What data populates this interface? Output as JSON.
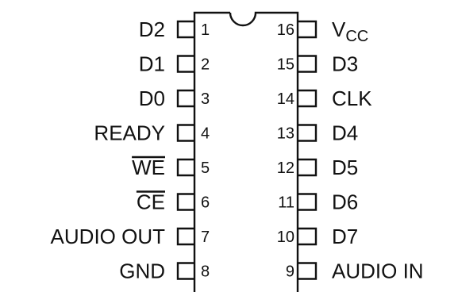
{
  "chip": {
    "left_pins": [
      {
        "number": "1",
        "label": "D2"
      },
      {
        "number": "2",
        "label": "D1"
      },
      {
        "number": "3",
        "label": "D0"
      },
      {
        "number": "4",
        "label": "READY"
      },
      {
        "number": "5",
        "label": "WE",
        "overline": true
      },
      {
        "number": "6",
        "label": "CE",
        "overline": true
      },
      {
        "number": "7",
        "label": "AUDIO OUT"
      },
      {
        "number": "8",
        "label": "GND"
      }
    ],
    "right_pins": [
      {
        "number": "16",
        "label": "V",
        "subscript": "CC"
      },
      {
        "number": "15",
        "label": "D3"
      },
      {
        "number": "14",
        "label": "CLK"
      },
      {
        "number": "13",
        "label": "D4"
      },
      {
        "number": "12",
        "label": "D5"
      },
      {
        "number": "11",
        "label": "D6"
      },
      {
        "number": "10",
        "label": "D7"
      },
      {
        "number": "9",
        "label": "AUDIO IN"
      }
    ]
  }
}
